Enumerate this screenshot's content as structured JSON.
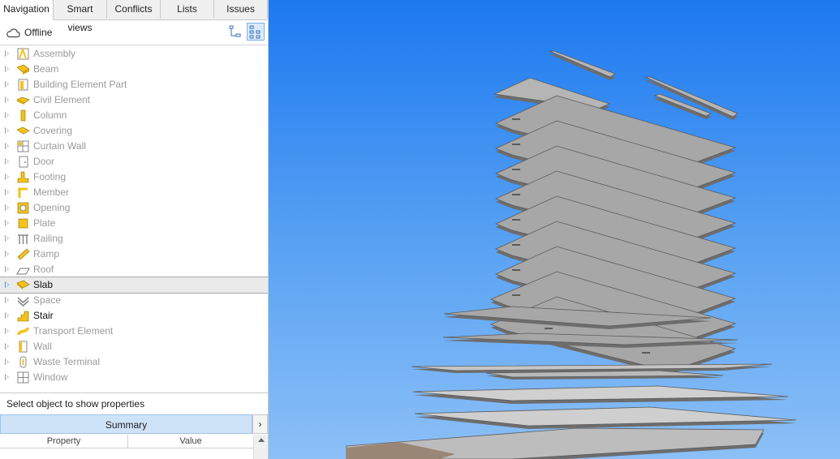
{
  "tabs": [
    {
      "label": "Navigation",
      "active": true
    },
    {
      "label": "Smart views",
      "active": false
    },
    {
      "label": "Conflicts",
      "active": false
    },
    {
      "label": "Lists",
      "active": false
    },
    {
      "label": "Issues",
      "active": false
    }
  ],
  "status": {
    "label": "Offline",
    "icon": "cloud-icon"
  },
  "toolbar": [
    {
      "name": "tree-view-icon",
      "selected": false
    },
    {
      "name": "grid-view-icon",
      "selected": true
    }
  ],
  "tree_items": [
    {
      "label": "Assembly",
      "icon": "assembly-icon",
      "active": false
    },
    {
      "label": "Beam",
      "icon": "beam-icon",
      "active": false
    },
    {
      "label": "Building Element Part",
      "icon": "building-element-part-icon",
      "active": false
    },
    {
      "label": "Civil Element",
      "icon": "civil-element-icon",
      "active": false
    },
    {
      "label": "Column",
      "icon": "column-icon",
      "active": false
    },
    {
      "label": "Covering",
      "icon": "covering-icon",
      "active": false
    },
    {
      "label": "Curtain Wall",
      "icon": "curtain-wall-icon",
      "active": false
    },
    {
      "label": "Door",
      "icon": "door-icon",
      "active": false
    },
    {
      "label": "Footing",
      "icon": "footing-icon",
      "active": false
    },
    {
      "label": "Member",
      "icon": "member-icon",
      "active": false
    },
    {
      "label": "Opening",
      "icon": "opening-icon",
      "active": false
    },
    {
      "label": "Plate",
      "icon": "plate-icon",
      "active": false
    },
    {
      "label": "Railing",
      "icon": "railing-icon",
      "active": false
    },
    {
      "label": "Ramp",
      "icon": "ramp-icon",
      "active": false
    },
    {
      "label": "Roof",
      "icon": "roof-icon",
      "active": false
    },
    {
      "label": "Slab",
      "icon": "slab-icon",
      "active": true,
      "selected": true
    },
    {
      "label": "Space",
      "icon": "space-icon",
      "active": false
    },
    {
      "label": "Stair",
      "icon": "stair-icon",
      "active": true
    },
    {
      "label": "Transport Element",
      "icon": "transport-element-icon",
      "active": false
    },
    {
      "label": "Wall",
      "icon": "wall-icon",
      "active": false
    },
    {
      "label": "Waste Terminal",
      "icon": "waste-terminal-icon",
      "active": false
    },
    {
      "label": "Window",
      "icon": "window-icon",
      "active": false
    }
  ],
  "properties": {
    "hint": "Select object to show properties",
    "summary_label": "Summary",
    "expand_glyph": "›",
    "columns": [
      "Property",
      "Value"
    ]
  },
  "colors": {
    "icon_yellow": "#f4c21b",
    "viewport_top": "#1d79f0",
    "viewport_bottom": "#8cc0f7",
    "slab_fill": "#a7a7a7",
    "slab_edge": "#5b5b5b"
  }
}
